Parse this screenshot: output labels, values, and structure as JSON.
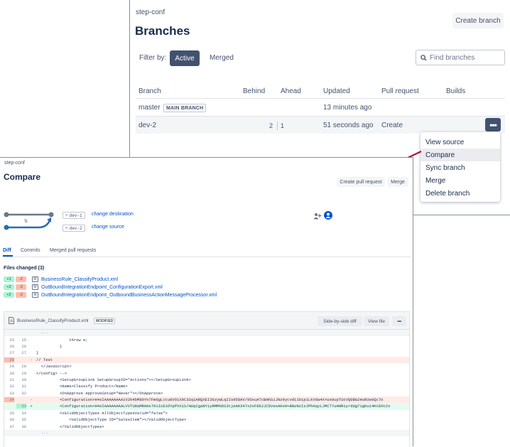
{
  "branches_window": {
    "repo": "step-conf",
    "title": "Branches",
    "create_branch": "Create branch",
    "filter_label": "Filter by:",
    "filter_active": "Active",
    "filter_merged": "Merged",
    "search_placeholder": "Find branches",
    "columns": [
      "Branch",
      "Behind",
      "Ahead",
      "Updated",
      "Pull request",
      "Builds"
    ],
    "rows": [
      {
        "branch": "master",
        "badge": "MAIN BRANCH",
        "behind": "",
        "ahead": "",
        "updated": "13 minutes ago",
        "pull_request": ""
      },
      {
        "branch": "dev-2",
        "badge": "",
        "behind": "2",
        "ahead": "1",
        "updated": "51 seconds ago",
        "pull_request": "Create"
      }
    ],
    "actions_button": "•••",
    "menu": [
      "View source",
      "Compare",
      "Sync branch",
      "Merge",
      "Delete branch"
    ],
    "menu_highlighted": "Compare"
  },
  "compare_window": {
    "repo": "step-conf",
    "title": "Compare",
    "create_pr": "Create pull request",
    "merge": "Merge",
    "destination_branch": "dev-1",
    "destination_link": "change destination",
    "source_branch": "dev-2",
    "source_link": "change source",
    "tabs": [
      "Diff",
      "Commits",
      "Merged pull requests"
    ],
    "active_tab": "Diff",
    "files_changed_title": "Files changed (3)",
    "files": [
      {
        "added": "+1",
        "removed": "-2",
        "type": "M",
        "name": "BusinessRule_ClassifyProduct.xml"
      },
      {
        "added": "+2",
        "removed": "-2",
        "type": "M",
        "name": "OutBoundIntegrationEndpoint_ConfigurationExport.xml"
      },
      {
        "added": "+2",
        "removed": "-2",
        "type": "M",
        "name": "OutBoundIntegrationEndpoint_OutboundBusinessActionMessageProcessor.xml"
      }
    ],
    "diff": {
      "file": "BusinessRule_ClassifyProduct.xml",
      "badge": "MODIFIED",
      "side_by_side": "Side-by-side diff",
      "view_file": "View file",
      "more": "•••",
      "lines": [
        {
          "kind": "hunk",
          "old": "",
          "new": "",
          "marker": "",
          "text": "  ···"
        },
        {
          "kind": "ctx",
          "old": "25",
          "new": "25",
          "marker": "",
          "text": "              throw e;"
        },
        {
          "kind": "ctx",
          "old": "26",
          "new": "26",
          "marker": "",
          "text": "          }"
        },
        {
          "kind": "ctx",
          "old": "27",
          "new": "27",
          "marker": "",
          "text": "}"
        },
        {
          "kind": "del",
          "old": "28",
          "new": "",
          "marker": "-",
          "text": "// Test"
        },
        {
          "kind": "ctx",
          "old": "29",
          "new": "28",
          "marker": "",
          "text": "  </JavaScript>"
        },
        {
          "kind": "ctx",
          "old": "30",
          "new": "29",
          "marker": "",
          "text": "</config> -->"
        },
        {
          "kind": "ctx",
          "old": "31",
          "new": "30",
          "marker": "",
          "text": "          <SetupGroupLink SetupGroupID=\"Actions\"></SetupGroupLink>"
        },
        {
          "kind": "ctx",
          "old": "32",
          "new": "31",
          "marker": "",
          "text": "          <Name>Classify Product</Name>"
        },
        {
          "kind": "ctx",
          "old": "33",
          "new": "32",
          "marker": "",
          "text": "          <OnApprove ApproveSetup=\"Never\"></OnApprove>"
        },
        {
          "kind": "del",
          "old": "34",
          "new": "",
          "marker": "-",
          "text": "          <Configuration>H4sIAAAAAAAA1V204bM89Yn7Fm8gLctu0VO1X0C3Sq1ARQXEI36zyWLq2Is958AV/95xuATcBmhSiJNz9ycvd11bip1LkVda4X+Us0upTUtVQ0BG2HuR3e0Qc7o"
        },
        {
          "kind": "add",
          "old": "",
          "new": "33",
          "marker": "+",
          "text": "          <Configuration>H4sIAAAAAAAALVVTU8aMRA9s79iIcE1OYpPVXiS/mUqIgaNY1yRMMG6S3tjeAK347x2vF8k2JC5VesAKn9+BNzNzIzJPhAqyLJMCT7uHHR1yrdUg71gKu14KtEOt2v"
        },
        {
          "kind": "ctx",
          "old": "35",
          "new": "34",
          "marker": "",
          "text": "          <ValidObjectTypes AllObjectTypesValid=\"false\">"
        },
        {
          "kind": "ctx",
          "old": "36",
          "new": "35",
          "marker": "",
          "text": "              <ValidObjectType ID=\"SalesItem\"></ValidObjectType>"
        },
        {
          "kind": "ctx",
          "old": "37",
          "new": "36",
          "marker": "",
          "text": "          </ValidObjectTypes>"
        },
        {
          "kind": "hunk",
          "old": "",
          "new": "",
          "marker": "",
          "text": "  ···"
        }
      ]
    }
  },
  "colors": {
    "accent": "#0052cc",
    "arrow": "#a6192e",
    "active_filter": "#42526e"
  }
}
